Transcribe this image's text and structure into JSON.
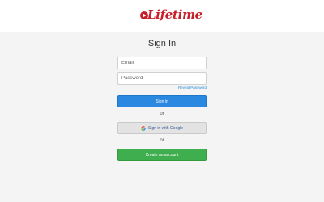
{
  "header": {
    "logo_text": "Lifetime"
  },
  "signin": {
    "title": "Sign In",
    "email_placeholder": "Email",
    "password_placeholder": "Password",
    "reveal_password": "Reveal Password",
    "signin_button": "Sign in",
    "or_1": "or",
    "google_button": "Sign in with Google",
    "or_2": "or",
    "create_button": "Create an account"
  },
  "colors": {
    "brand_red": "#c8202a",
    "primary_blue": "#2a88e0",
    "success_green": "#3fae4e",
    "google_gray": "#e3e3e3"
  }
}
